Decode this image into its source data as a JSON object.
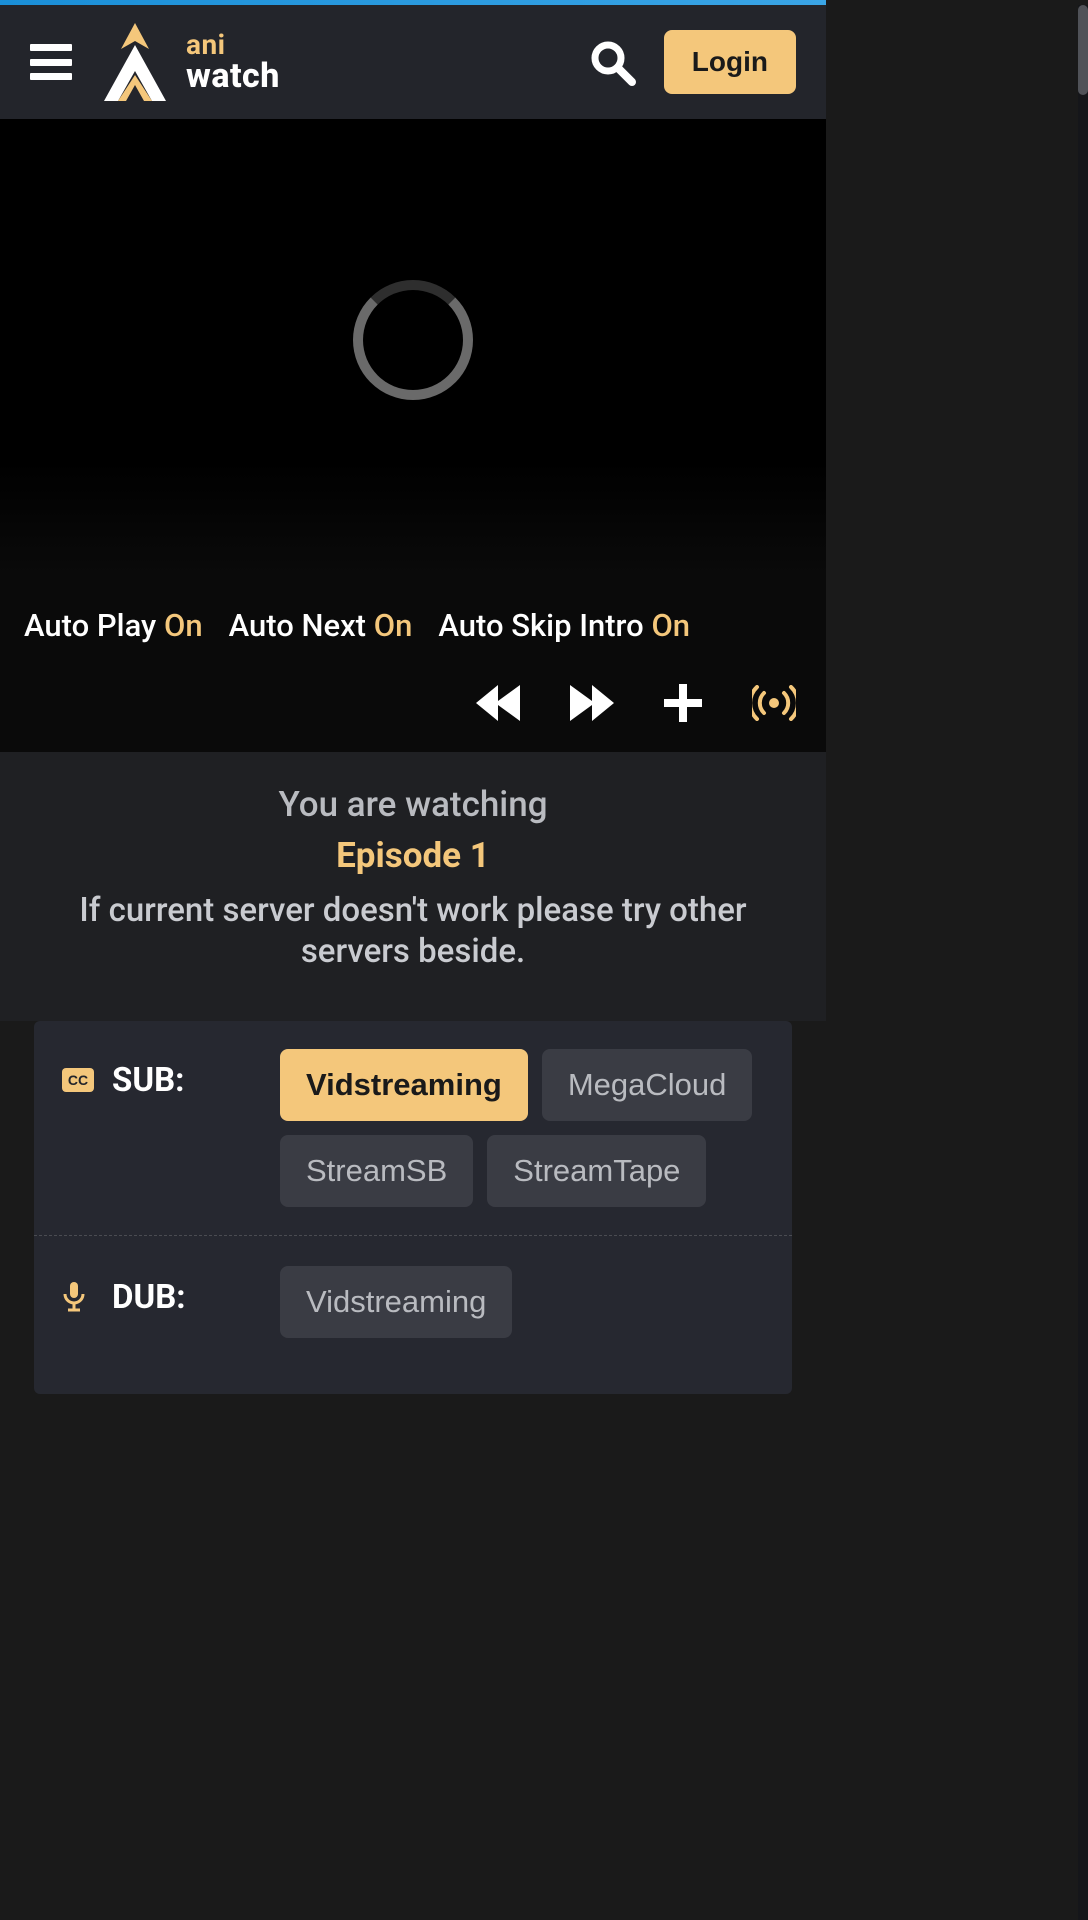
{
  "header": {
    "brand_top": "ani",
    "brand_bottom": "watch",
    "login_label": "Login"
  },
  "toggles": {
    "autoplay_label": "Auto Play",
    "autoplay_value": "On",
    "autonext_label": "Auto Next",
    "autonext_value": "On",
    "autoskip_label": "Auto Skip Intro",
    "autoskip_value": "On"
  },
  "watching": {
    "line1": "You are watching",
    "episode": "Episode 1",
    "hint": "If current server doesn't work please try other servers beside."
  },
  "servers": {
    "sub_label": "SUB:",
    "dub_label": "DUB:",
    "sub_options": {
      "vidstreaming": "Vidstreaming",
      "megacloud": "MegaCloud",
      "streamsb": "StreamSB",
      "streamtape": "StreamTape"
    },
    "dub_options": {
      "vidstreaming": "Vidstreaming"
    }
  }
}
